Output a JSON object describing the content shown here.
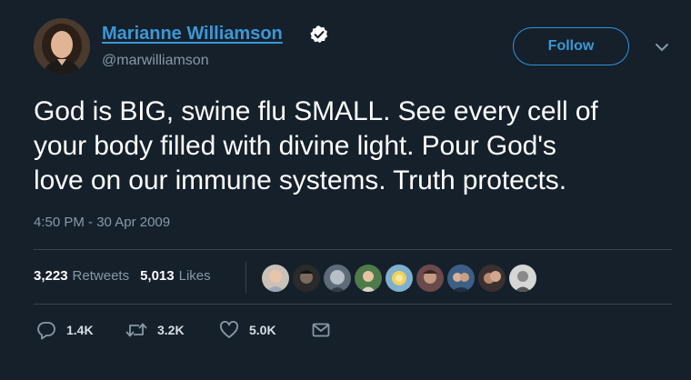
{
  "user": {
    "display_name": "Marianne Williamson",
    "handle": "@marwilliamson",
    "verified": true
  },
  "follow_button": {
    "label": "Follow"
  },
  "tweet": {
    "text": "God is BIG, swine flu SMALL.  See every cell of\nyour body filled with divine light. Pour God's\nlove on our immune systems. Truth protects.",
    "timestamp": "4:50 PM - 30 Apr 2009"
  },
  "stats": {
    "retweets": {
      "count": "3,223",
      "label": "Retweets"
    },
    "likes": {
      "count": "5,013",
      "label": "Likes"
    }
  },
  "likers": [
    {
      "icon": "avatar"
    },
    {
      "icon": "avatar"
    },
    {
      "icon": "avatar"
    },
    {
      "icon": "avatar"
    },
    {
      "icon": "avatar"
    },
    {
      "icon": "avatar"
    },
    {
      "icon": "avatar"
    },
    {
      "icon": "avatar"
    },
    {
      "icon": "avatar"
    }
  ],
  "actions": {
    "reply": {
      "icon": "reply-icon",
      "count": "1.4K"
    },
    "retweet": {
      "icon": "retweet-icon",
      "count": "3.2K"
    },
    "like": {
      "icon": "heart-icon",
      "count": "5.0K"
    },
    "message": {
      "icon": "envelope-icon"
    }
  },
  "colors": {
    "background": "#15202b",
    "accent": "#1da1f2",
    "link": "#3a98d6",
    "muted": "#8899a6",
    "divider": "#38444d"
  }
}
